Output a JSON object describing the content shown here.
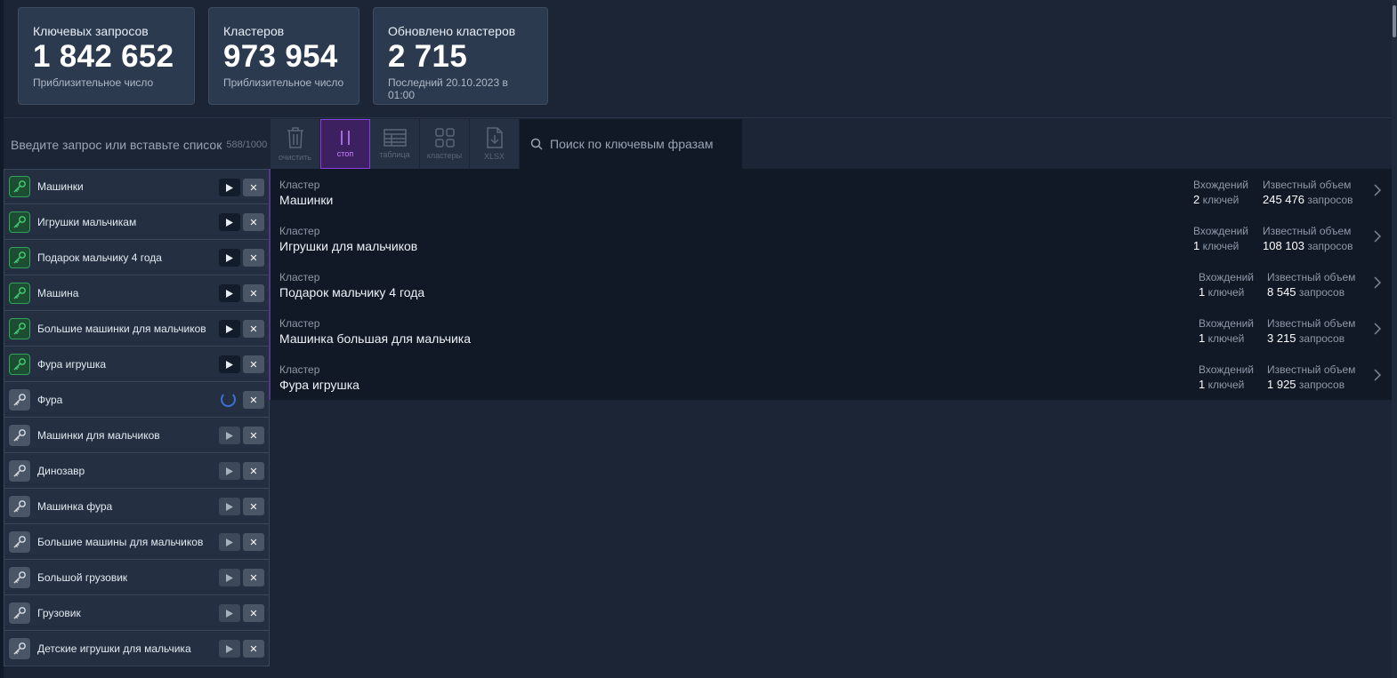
{
  "stats": [
    {
      "title": "Ключевых запросов",
      "value": "1 842 652",
      "sub": "Приблизительное число"
    },
    {
      "title": "Кластеров",
      "value": "973 954",
      "sub": "Приблизительное число"
    },
    {
      "title": "Обновлено кластеров",
      "value": "2 715",
      "sub": "Последний 20.10.2023 в 01:00"
    }
  ],
  "query": {
    "placeholder": "Введите запрос или вставьте список",
    "counter": "588/1000"
  },
  "toolbar": {
    "clear": "очистить",
    "stop": "стоп",
    "table": "таблица",
    "clusters": "кластеры",
    "xlsx": "XLSX",
    "search_placeholder": "Поиск по ключевым фразам"
  },
  "keywords": [
    {
      "label": "Машинки",
      "status": "done"
    },
    {
      "label": "Игрушки мальчикам",
      "status": "done"
    },
    {
      "label": "Подарок мальчику 4 года",
      "status": "done"
    },
    {
      "label": "Машина",
      "status": "done"
    },
    {
      "label": "Большие машинки для мальчиков",
      "status": "done"
    },
    {
      "label": "Фура игрушка",
      "status": "done"
    },
    {
      "label": "Фура",
      "status": "loading"
    },
    {
      "label": "Машинки для мальчиков",
      "status": "pending"
    },
    {
      "label": "Динозавр",
      "status": "pending"
    },
    {
      "label": "Машинка фура",
      "status": "pending"
    },
    {
      "label": "Большие машины для мальчиков",
      "status": "pending"
    },
    {
      "label": "Большой грузовик",
      "status": "pending"
    },
    {
      "label": "Грузовик",
      "status": "pending"
    },
    {
      "label": "Детские игрушки для мальчика",
      "status": "pending"
    }
  ],
  "cluster_labels": {
    "caption": "Кластер",
    "occurrences": "Вхождений",
    "volume": "Известный объем",
    "keys_unit": "ключей",
    "requests_unit": "запросов"
  },
  "clusters": [
    {
      "name": "Машинки",
      "occurrences": "2",
      "volume": "245 476"
    },
    {
      "name": "Игрушки для мальчиков",
      "occurrences": "1",
      "volume": "108 103"
    },
    {
      "name": "Подарок мальчику 4 года",
      "occurrences": "1",
      "volume": "8 545"
    },
    {
      "name": "Машинка большая для мальчика",
      "occurrences": "1",
      "volume": "3 215"
    },
    {
      "name": "Фура игрушка",
      "occurrences": "1",
      "volume": "1 925"
    }
  ],
  "colors": {
    "accent": "#8a3fe0",
    "done": "#2ea35a",
    "spinner": "#3e6fd8"
  }
}
